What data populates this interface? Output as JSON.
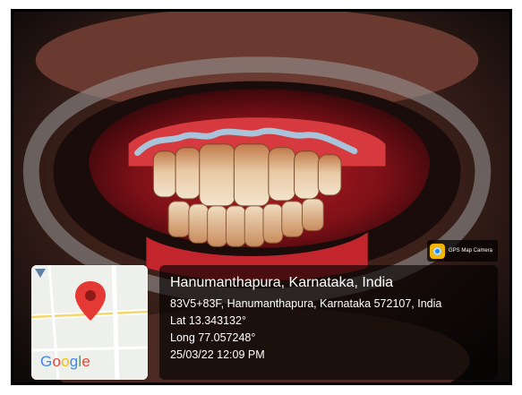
{
  "location": {
    "title": "Hanumanthapura, Karnataka, India",
    "address": "83V5+83F, Hanumanthapura, Karnataka 572107, India",
    "latitude": "Lat 13.343132°",
    "longitude": "Long 77.057248°",
    "datetime": "25/03/22 12:09 PM"
  },
  "badge": {
    "label": "GPS Map Camera",
    "icon": "gps-map-camera-app-icon"
  },
  "map": {
    "logo_text": "Google",
    "logo_colors": [
      "#4285F4",
      "#EA4335",
      "#FBBC05",
      "#4285F4",
      "#34A853",
      "#EA4335"
    ],
    "pin_color": "#E53935",
    "pin_icon": "map-pin-icon"
  },
  "photo": {
    "subject": "dental-photo"
  }
}
